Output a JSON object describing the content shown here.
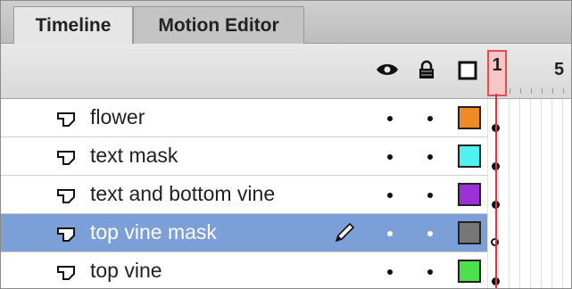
{
  "tabs": [
    {
      "label": "Timeline",
      "active": true
    },
    {
      "label": "Motion Editor",
      "active": false
    }
  ],
  "header": {
    "icons": [
      "eye-icon",
      "lock-icon",
      "outline-square-icon"
    ],
    "current_frame": "1",
    "ruler_label": "5"
  },
  "layers": [
    {
      "name": "flower",
      "color": "#f08a24",
      "selected": false,
      "keyframe": "filled"
    },
    {
      "name": "text mask",
      "color": "#4ff0f0",
      "selected": false,
      "keyframe": "filled"
    },
    {
      "name": "text and bottom vine",
      "color": "#9b30d6",
      "selected": false,
      "keyframe": "filled"
    },
    {
      "name": "top vine mask",
      "color": "#777777",
      "selected": true,
      "keyframe": "empty"
    },
    {
      "name": "top vine",
      "color": "#4ce04c",
      "selected": false,
      "keyframe": "filled"
    }
  ],
  "colors": {
    "selection": "#7b9fd6",
    "playhead": "#d23a3a"
  }
}
